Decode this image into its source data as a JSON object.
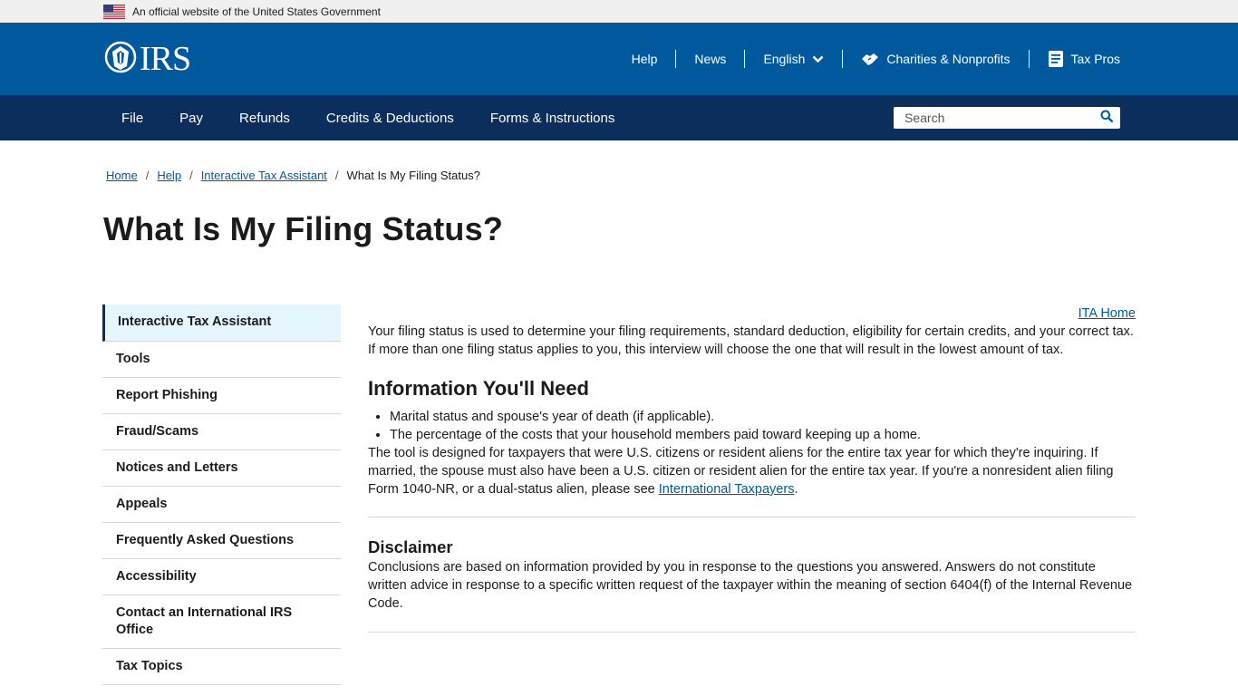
{
  "gov_banner": {
    "text": "An official website of the United States Government"
  },
  "header": {
    "logo_text": "IRS",
    "util_nav": {
      "help": "Help",
      "news": "News",
      "language": "English",
      "charities": "Charities & Nonprofits",
      "tax_pros": "Tax Pros"
    }
  },
  "main_nav": {
    "items": [
      "File",
      "Pay",
      "Refunds",
      "Credits & Deductions",
      "Forms & Instructions"
    ],
    "search_placeholder": "Search"
  },
  "breadcrumb": {
    "items": [
      "Home",
      "Help",
      "Interactive Tax Assistant"
    ],
    "current": "What Is My Filing Status?"
  },
  "page_title": "What Is My Filing Status?",
  "sidebar": {
    "items": [
      "Interactive Tax Assistant",
      "Tools",
      "Report Phishing",
      "Fraud/Scams",
      "Notices and Letters",
      "Appeals",
      "Frequently Asked Questions",
      "Accessibility",
      "Contact an International IRS Office",
      "Tax Topics"
    ]
  },
  "content": {
    "ita_home": "ITA Home",
    "intro": "Your filing status is used to determine your filing requirements, standard deduction, eligibility for certain credits, and your correct tax. If more than one filing status applies to you, this interview will choose the one that will result in the lowest amount of tax.",
    "info_heading": "Information You'll Need",
    "info_items": [
      "Marital status and spouse's year of death (if applicable).",
      "The percentage of the costs that your household members paid toward keeping up a home."
    ],
    "tool_note_before": "The tool is designed for taxpayers that were U.S. citizens or resident aliens for the entire tax year for which they're inquiring. If married, the spouse must also have been a U.S. citizen or resident alien for the entire tax year. If you're a nonresident alien filing Form 1040-NR, or a dual-status alien, please see ",
    "tool_note_link": "International Taxpayers",
    "tool_note_after": ".",
    "disclaimer_heading": "Disclaimer",
    "disclaimer_text": "Conclusions are based on information provided by you in response to the questions you answered. Answers do not constitute written advice in response to a specific written request of the taxpayer within the meaning of section 6404(f) of the Internal Revenue Code."
  },
  "colors": {
    "header_blue": "#00599c",
    "nav_navy": "#0b2e5c",
    "link": "#00599c",
    "active_sidebar_bg": "#e6f6fd"
  },
  "icons": [
    "us-flag-icon",
    "irs-eagle-icon",
    "chevron-down-icon",
    "handshake-icon",
    "document-icon",
    "search-icon"
  ]
}
